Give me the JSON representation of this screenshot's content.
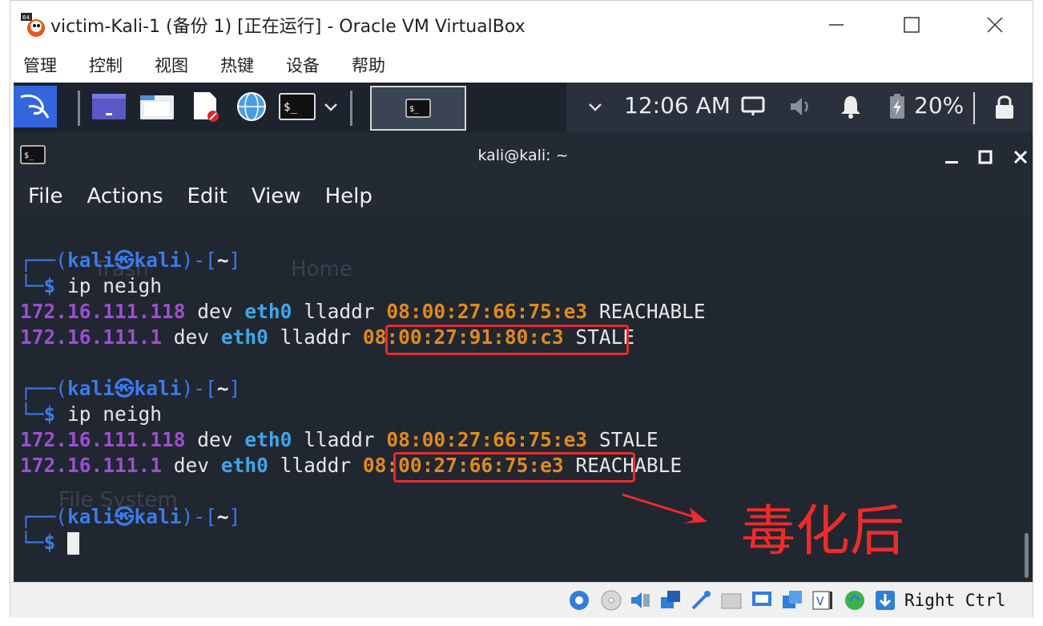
{
  "window": {
    "title": "victim-Kali-1 (备份 1) [正在运行] - Oracle VM VirtualBox"
  },
  "vbox_menu": [
    "管理",
    "控制",
    "视图",
    "热键",
    "设备",
    "帮助"
  ],
  "panel": {
    "clock": "12:06 AM",
    "battery": "20%"
  },
  "terminal": {
    "title": "kali@kali: ~",
    "menu": [
      "File",
      "Actions",
      "Edit",
      "View",
      "Help"
    ],
    "prompt": {
      "top": "┌──(",
      "user": "kali",
      "at": "㉿",
      "host": "kali",
      "close": ")-[",
      "path": "~",
      "end": "]",
      "bottom": "└─",
      "dollar": "$"
    },
    "command": "ip neigh",
    "blocks": [
      [
        {
          "ip": "172.16.111.118",
          "dev": "eth0",
          "mac": "08:00:27:66:75:e3",
          "state": "REACHABLE"
        },
        {
          "ip": "172.16.111.1",
          "dev": "eth0",
          "mac": "08:00:27:91:80:c3",
          "state": "STALE"
        }
      ],
      [
        {
          "ip": "172.16.111.118",
          "dev": "eth0",
          "mac": "08:00:27:66:75:e3",
          "state": "STALE"
        },
        {
          "ip": "172.16.111.1",
          "dev": "eth0",
          "mac": "08:00:27:66:75:e3",
          "state": "REACHABLE"
        }
      ]
    ],
    "words": {
      "dev": "dev",
      "lladdr": "lladdr"
    }
  },
  "desktop_watermark": {
    "trash": "Trash",
    "home": "Home",
    "filesystem": "File System"
  },
  "annotation": "毒化后",
  "statusbar": {
    "host_key": "Right Ctrl"
  },
  "colors": {
    "prompt_blue": "#3a7bea",
    "ip_purple": "#9b4fd3",
    "mac_orange": "#e08a1e",
    "highlight_red": "#e52b2b"
  }
}
